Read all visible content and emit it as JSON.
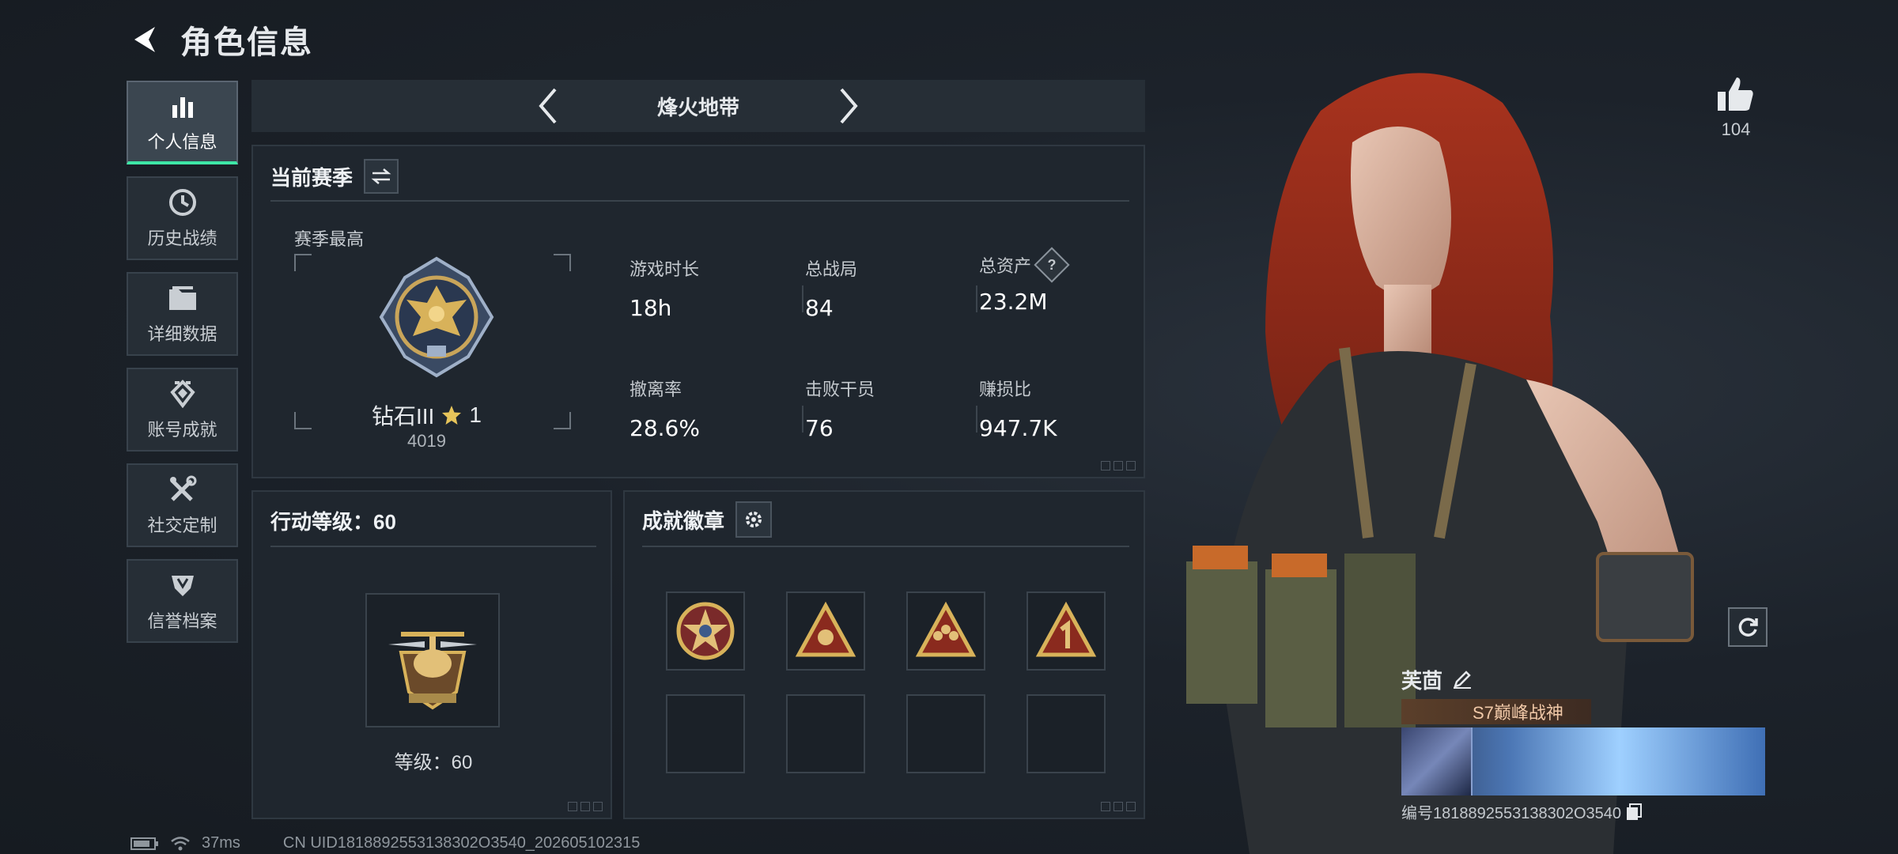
{
  "header": {
    "title": "角色信息"
  },
  "sidebar": {
    "items": [
      {
        "label": "个人信息",
        "icon": "bar-chart-icon",
        "active": true
      },
      {
        "label": "历史战绩",
        "icon": "clock-icon"
      },
      {
        "label": "详细数据",
        "icon": "folder-icon"
      },
      {
        "label": "账号成就",
        "icon": "achievement-icon"
      },
      {
        "label": "社交定制",
        "icon": "tools-icon"
      },
      {
        "label": "信誉档案",
        "icon": "shield-icon"
      }
    ]
  },
  "mode_switcher": {
    "current": "烽火地带"
  },
  "season": {
    "title": "当前赛季",
    "best_label": "赛季最高",
    "rank_name": "钻石III",
    "rank_stars": "1",
    "rank_score": "4019",
    "stats": [
      {
        "label": "游戏时长",
        "value": "18h"
      },
      {
        "label": "总战局",
        "value": "84"
      },
      {
        "label": "总资产",
        "value": "23.2M",
        "help": "?"
      },
      {
        "label": "撤离率",
        "value": "28.6%"
      },
      {
        "label": "击败干员",
        "value": "76"
      },
      {
        "label": "赚损比",
        "value": "947.7K"
      }
    ]
  },
  "action_level": {
    "title": "行动等级：60",
    "level_text": "等级：60"
  },
  "achievements": {
    "title": "成就徽章"
  },
  "like": {
    "count": "104"
  },
  "profile": {
    "name": "芙茴",
    "title": "S7巅峰战神",
    "uid_line": "编号1818892553138302O3540"
  },
  "footer": {
    "ping": "37ms",
    "uid": "CN UID1818892553138302O3540_202605102315"
  },
  "colors": {
    "accent": "#3ee6a6",
    "panel": "#1f262e",
    "gold": "#d8b25a"
  }
}
